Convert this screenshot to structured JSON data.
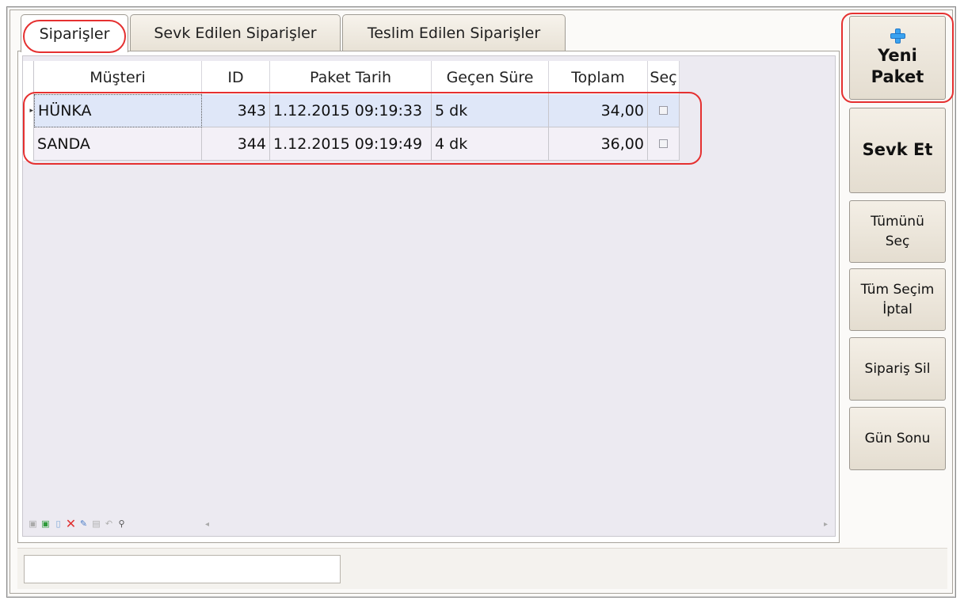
{
  "tabs": [
    {
      "label": "Siparişler",
      "active": true
    },
    {
      "label": "Sevk Edilen Siparişler",
      "active": false
    },
    {
      "label": "Teslim Edilen Siparişler",
      "active": false
    }
  ],
  "grid": {
    "columns": [
      "Müşteri",
      "ID",
      "Paket Tarih",
      "Geçen Süre",
      "Toplam",
      "Seç"
    ],
    "rows": [
      {
        "musteri": "HÜNKA",
        "id": "343",
        "tarih": "1.12.2015 09:19:33",
        "sure": "5 dk",
        "toplam": "34,00",
        "sec": false
      },
      {
        "musteri": "SANDA",
        "id": "344",
        "tarih": "1.12.2015 09:19:49",
        "sure": "4 dk",
        "toplam": "36,00",
        "sec": false
      }
    ]
  },
  "buttons": {
    "new_package_line1": "Yeni",
    "new_package_line2": "Paket",
    "dispatch": "Sevk Et",
    "select_all_line1": "Tümünü",
    "select_all_line2": "Seç",
    "deselect_all_line1": "Tüm Seçim",
    "deselect_all_line2": "İptal",
    "delete_order": "Sipariş Sil",
    "end_of_day": "Gün Sonu"
  },
  "status_input": {
    "value": ""
  },
  "icons": {
    "new_package": "plus-icon",
    "row_indicator": "row-pointer-icon"
  },
  "colors": {
    "highlight": "#e53030",
    "selected_row": "#dfe7f8",
    "accent": "#3aa3f0"
  }
}
